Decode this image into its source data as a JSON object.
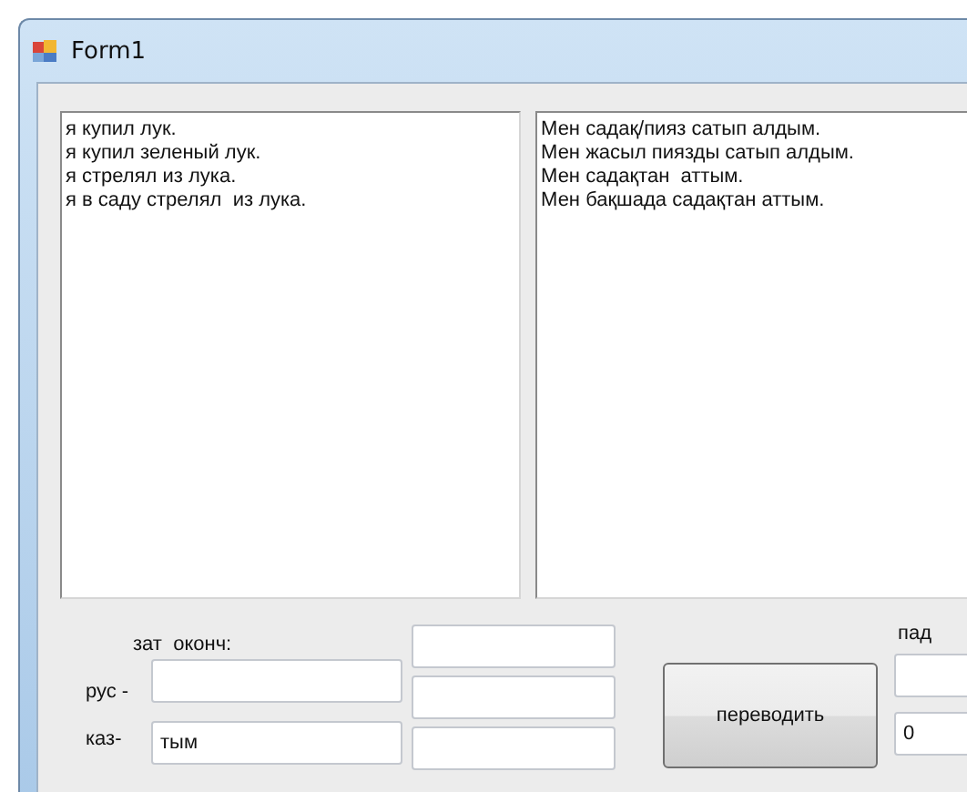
{
  "window": {
    "title": "Form1"
  },
  "russian_text": {
    "lines": [
      "я купил лук.",
      "я купил зеленый лук.",
      "я стрелял из лука.",
      "я в саду стрелял  из лука."
    ]
  },
  "kazakh_text": {
    "lines": [
      "Мен садақ/пияз сатып алдым.",
      "Мен жасыл пиязды сатып алдым.",
      "Мен садақтан  аттым.",
      "Мен бақшада садақтан аттым."
    ]
  },
  "ending_label": "зат  оконч:",
  "rus_label": "рус -",
  "kaz_label": "каз-",
  "kaz_field": {
    "value": "тым"
  },
  "translate_button": "переводить",
  "case_label": "пад",
  "count_field": {
    "value": "0"
  }
}
